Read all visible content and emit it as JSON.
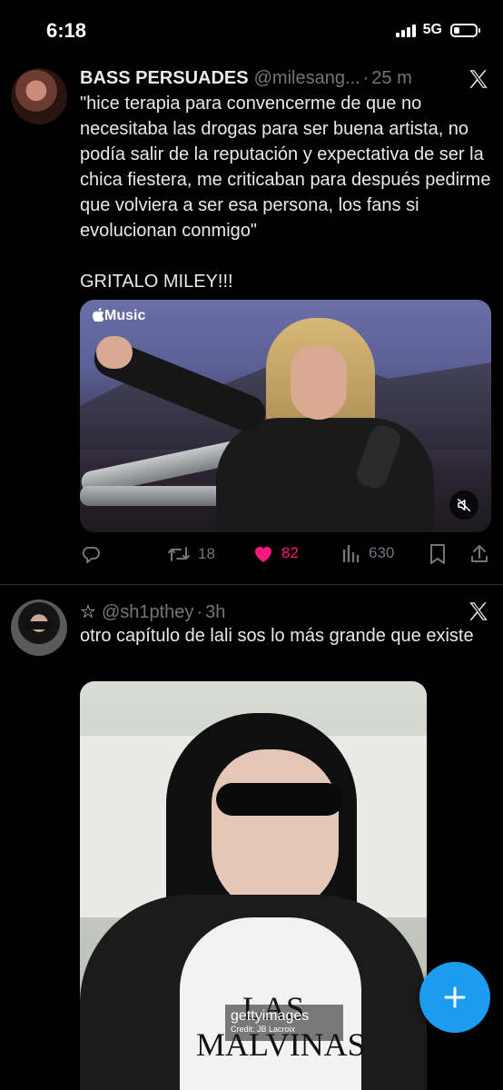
{
  "status_bar": {
    "time": "6:18",
    "network": "5G"
  },
  "tweets": [
    {
      "author": {
        "name": "BASS PERSUADES",
        "handle": "@milesang...",
        "time": "25 m"
      },
      "text": "\"hice terapia para convencerme de que no necesitaba las drogas para ser buena artista, no podía salir de la reputación y expectativa de ser la chica fiestera, me criticaban para después pedirme que volviera a ser esa persona, los fans si evolucionan conmigo\"\n\nGRITALO MILEY!!!",
      "media": {
        "badge": "Music"
      },
      "actions": {
        "retweets": "18",
        "likes": "82",
        "views": "630"
      }
    },
    {
      "author": {
        "star": "☆",
        "handle": "@sh1pthey",
        "time": "3h"
      },
      "text": "otro capítulo de lali sos lo más grande que existe",
      "media": {
        "watermark": "gettyimages",
        "credit": "Credit: JB Lacroix",
        "shirt_text": "LAS MALVINAS"
      }
    }
  ],
  "colors": {
    "accent": "#1d9bf0",
    "like": "#f91880",
    "muted": "#71767b"
  }
}
